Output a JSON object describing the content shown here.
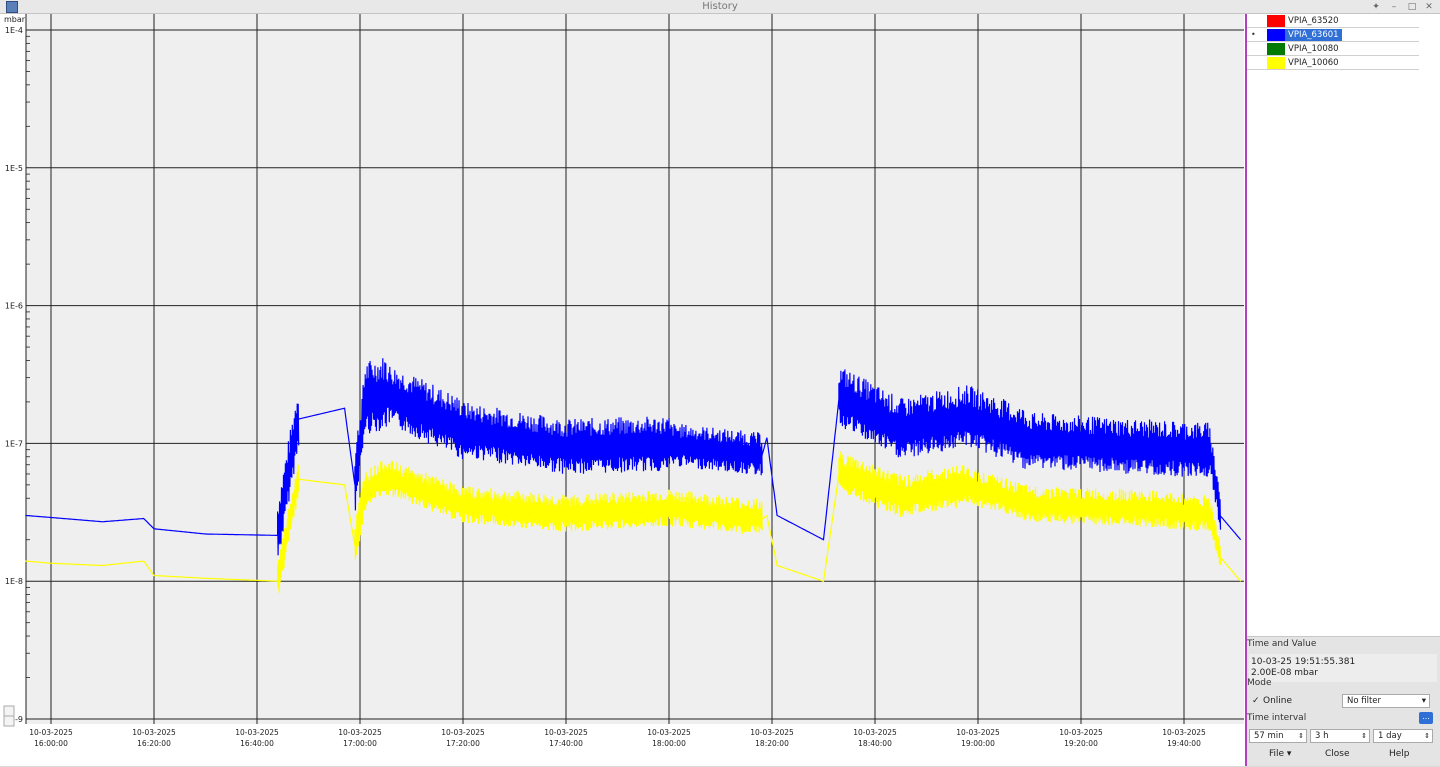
{
  "window": {
    "title": "History"
  },
  "chart_data": {
    "type": "line",
    "ylabel": "mbar",
    "y_scale": "log",
    "ylim": [
      1e-09,
      0.0001
    ],
    "y_ticks": [
      "1E-4",
      "1E-5",
      "1E-6",
      "1E-7",
      "1E-8",
      "1E-9"
    ],
    "x_ticks": [
      {
        "date": "10-03-2025",
        "time": "16:00:00"
      },
      {
        "date": "10-03-2025",
        "time": "16:20:00"
      },
      {
        "date": "10-03-2025",
        "time": "16:40:00"
      },
      {
        "date": "10-03-2025",
        "time": "17:00:00"
      },
      {
        "date": "10-03-2025",
        "time": "17:20:00"
      },
      {
        "date": "10-03-2025",
        "time": "17:40:00"
      },
      {
        "date": "10-03-2025",
        "time": "18:00:00"
      },
      {
        "date": "10-03-2025",
        "time": "18:20:00"
      },
      {
        "date": "10-03-2025",
        "time": "18:40:00"
      },
      {
        "date": "10-03-2025",
        "time": "19:00:00"
      },
      {
        "date": "10-03-2025",
        "time": "19:20:00"
      },
      {
        "date": "10-03-2025",
        "time": "19:40:00"
      }
    ],
    "grid": true,
    "series": [
      {
        "name": "VPIA_63601",
        "color": "#0000ff",
        "noise": [
          0,
          0,
          0,
          0,
          0,
          0,
          0.5,
          0.5,
          0,
          0.5,
          0.6,
          0.6,
          0.5,
          0.45,
          0.45,
          0.35,
          0,
          0,
          0,
          0.5,
          0.55,
          0.5,
          0.5,
          0.45,
          0.45,
          0.4,
          0
        ],
        "points": [
          [
            "2025-03-10 15:55",
            3e-08
          ],
          [
            "2025-03-10 16:00",
            2.9e-08
          ],
          [
            "2025-03-10 16:10",
            2.7e-08
          ],
          [
            "2025-03-10 16:18",
            2.85e-08
          ],
          [
            "2025-03-10 16:20",
            2.4e-08
          ],
          [
            "2025-03-10 16:30",
            2.2e-08
          ],
          [
            "2025-03-10 16:44",
            2.15e-08
          ],
          [
            "2025-03-10 16:48",
            1.5e-07
          ],
          [
            "2025-03-10 16:57",
            1.8e-07
          ],
          [
            "2025-03-10 16:59",
            5e-08
          ],
          [
            "2025-03-10 17:01",
            2e-07
          ],
          [
            "2025-03-10 17:05",
            2.2e-07
          ],
          [
            "2025-03-10 17:20",
            1.2e-07
          ],
          [
            "2025-03-10 17:40",
            9e-08
          ],
          [
            "2025-03-10 18:00",
            9.5e-08
          ],
          [
            "2025-03-10 18:18",
            8e-08
          ],
          [
            "2025-03-10 18:19",
            1.1e-07
          ],
          [
            "2025-03-10 18:21",
            3e-08
          ],
          [
            "2025-03-10 18:30",
            2e-08
          ],
          [
            "2025-03-10 18:33",
            2.1e-07
          ],
          [
            "2025-03-10 18:45",
            1.2e-07
          ],
          [
            "2025-03-10 18:58",
            1.5e-07
          ],
          [
            "2025-03-10 19:10",
            1e-07
          ],
          [
            "2025-03-10 19:30",
            9e-08
          ],
          [
            "2025-03-10 19:45",
            8.5e-08
          ],
          [
            "2025-03-10 19:47",
            3e-08
          ],
          [
            "2025-03-10 19:51",
            2e-08
          ]
        ]
      },
      {
        "name": "VPIA_10060",
        "color": "#ffff00",
        "noise": [
          0,
          0,
          0,
          0,
          0,
          0,
          0.3,
          0.3,
          0,
          0.35,
          0.35,
          0.3,
          0.3,
          0.3,
          0.3,
          0.3,
          0,
          0,
          0,
          0.35,
          0.35,
          0.35,
          0.3,
          0.3,
          0.3,
          0.3,
          0
        ],
        "points": [
          [
            "2025-03-10 15:55",
            1.4e-08
          ],
          [
            "2025-03-10 16:00",
            1.35e-08
          ],
          [
            "2025-03-10 16:10",
            1.3e-08
          ],
          [
            "2025-03-10 16:18",
            1.4e-08
          ],
          [
            "2025-03-10 16:20",
            1.1e-08
          ],
          [
            "2025-03-10 16:30",
            1.05e-08
          ],
          [
            "2025-03-10 16:44",
            1e-08
          ],
          [
            "2025-03-10 16:48",
            5.5e-08
          ],
          [
            "2025-03-10 16:57",
            5e-08
          ],
          [
            "2025-03-10 16:59",
            1.8e-08
          ],
          [
            "2025-03-10 17:01",
            4.5e-08
          ],
          [
            "2025-03-10 17:05",
            5.5e-08
          ],
          [
            "2025-03-10 17:20",
            3.5e-08
          ],
          [
            "2025-03-10 17:40",
            3e-08
          ],
          [
            "2025-03-10 18:00",
            3.3e-08
          ],
          [
            "2025-03-10 18:18",
            2.8e-08
          ],
          [
            "2025-03-10 18:19",
            3e-08
          ],
          [
            "2025-03-10 18:21",
            1.3e-08
          ],
          [
            "2025-03-10 18:30",
            1e-08
          ],
          [
            "2025-03-10 18:33",
            6e-08
          ],
          [
            "2025-03-10 18:45",
            4e-08
          ],
          [
            "2025-03-10 18:58",
            4.8e-08
          ],
          [
            "2025-03-10 19:10",
            3.5e-08
          ],
          [
            "2025-03-10 19:30",
            3.3e-08
          ],
          [
            "2025-03-10 19:45",
            3e-08
          ],
          [
            "2025-03-10 19:47",
            1.5e-08
          ],
          [
            "2025-03-10 19:51",
            1e-08
          ]
        ]
      }
    ]
  },
  "legend": [
    {
      "name": "VPIA_63520",
      "color": "#ff0000",
      "selected": false,
      "marker": ""
    },
    {
      "name": "VPIA_63601",
      "color": "#0000ff",
      "selected": true,
      "marker": "•"
    },
    {
      "name": "VPIA_10080",
      "color": "#007a00",
      "selected": false,
      "marker": ""
    },
    {
      "name": "VPIA_10060",
      "color": "#ffff00",
      "selected": false,
      "marker": ""
    }
  ],
  "panel": {
    "time_value_label": "Time and Value",
    "readout_time": "10-03-25 19:51:55.381",
    "readout_value": "2.00E-08 mbar",
    "mode_label": "Mode",
    "online_label": "Online",
    "online_check": "✓",
    "filter_value": "No filter",
    "time_interval_label": "Time interval",
    "more_button": "...",
    "interval_1": "57 min",
    "interval_2": "3 h",
    "interval_3": "1 day"
  },
  "footer": {
    "file": "File",
    "close": "Close",
    "help": "Help"
  }
}
